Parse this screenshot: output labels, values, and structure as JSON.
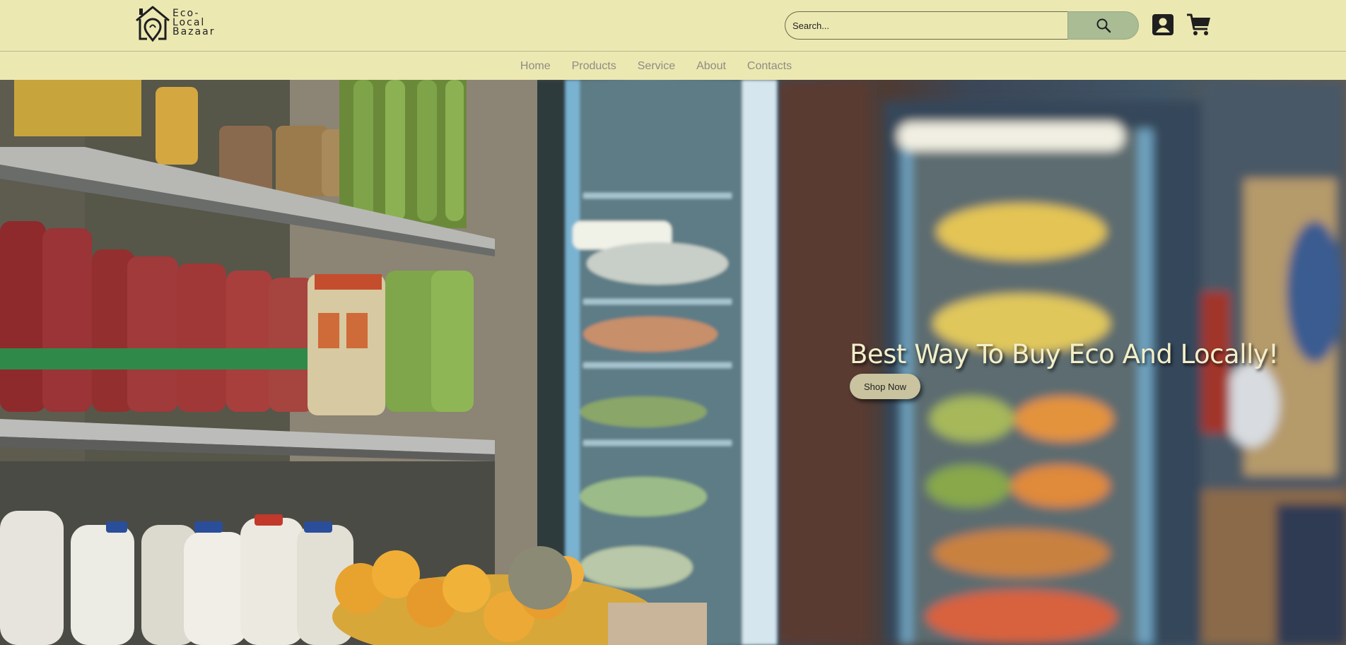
{
  "header": {
    "logo": {
      "line1": "Eco-",
      "line2": "Local",
      "line3": "Bazaar"
    },
    "search": {
      "placeholder": "Search...",
      "value": ""
    },
    "icons": {
      "search": "search-icon",
      "account": "user-icon",
      "cart": "cart-icon"
    }
  },
  "nav": {
    "items": [
      {
        "label": "Home"
      },
      {
        "label": "Products"
      },
      {
        "label": "Service"
      },
      {
        "label": "About"
      },
      {
        "label": "Contacts"
      }
    ]
  },
  "hero": {
    "title": "Best Way To Buy Eco And Locally!",
    "cta_label": "Shop Now"
  },
  "colors": {
    "header_bg": "#ece8b2",
    "search_button": "#a9bc94",
    "nav_text": "#8e8d80",
    "hero_text": "#f2efc9",
    "cta_bg": "#c9c49f"
  }
}
